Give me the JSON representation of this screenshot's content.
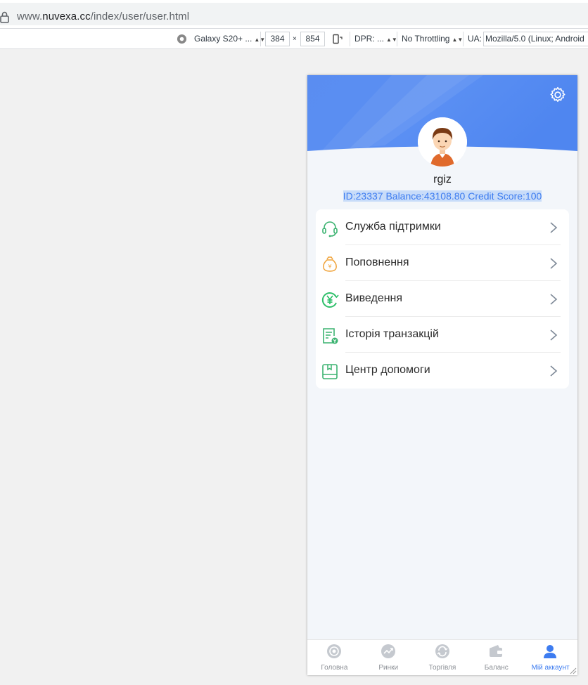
{
  "browser": {
    "url_prefix": "www.",
    "url_host": "nuvexa.cc",
    "url_path": "/index/user/user.html"
  },
  "devtools": {
    "device": "Galaxy S20+ ...",
    "width": "384",
    "times": "×",
    "height": "854",
    "dpr": "DPR: ...",
    "throttling": "No Throttling",
    "ua_label": "UA:",
    "ua_value": "Mozilla/5.0 (Linux; Android"
  },
  "profile": {
    "username": "rgiz",
    "info": "ID:23337  Balance:43108.80  Credit Score:100"
  },
  "menu": [
    {
      "label": "Служба підтримки",
      "icon": "headset-icon"
    },
    {
      "label": "Поповнення",
      "icon": "money-bag-icon"
    },
    {
      "label": "Виведення",
      "icon": "yen-withdraw-icon"
    },
    {
      "label": "Історія транзакцій",
      "icon": "transaction-history-icon"
    },
    {
      "label": "Центр допомоги",
      "icon": "help-book-icon"
    }
  ],
  "tabs": [
    {
      "label": "Головна",
      "icon": "home-icon",
      "active": false
    },
    {
      "label": "Ринки",
      "icon": "markets-icon",
      "active": false
    },
    {
      "label": "Торгівля",
      "icon": "trade-icon",
      "active": false
    },
    {
      "label": "Баланс",
      "icon": "wallet-icon",
      "active": false
    },
    {
      "label": "Мій аккаунт",
      "icon": "user-icon",
      "active": true
    }
  ],
  "colors": {
    "hero_blue": "#5b8ff2",
    "accent": "#3d7cf0",
    "green": "#3cb371",
    "orange": "#f0a33a"
  }
}
